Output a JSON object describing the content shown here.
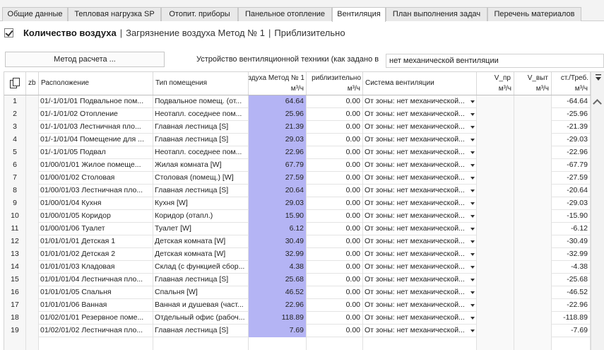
{
  "tabs": [
    {
      "label": "Общие данные",
      "active": false
    },
    {
      "label": "Тепловая нагрузка SP",
      "active": false
    },
    {
      "label": "Отопит. приборы",
      "active": false
    },
    {
      "label": "Панельное отопление",
      "active": false
    },
    {
      "label": "Вентиляция",
      "active": true
    },
    {
      "label": "План выполнения задач",
      "active": false
    },
    {
      "label": "Перечень материалов",
      "active": false
    }
  ],
  "headline": {
    "checked": true,
    "main": "Количество воздуха",
    "sep1": "|",
    "sub1": "Загрязнение воздуха Метод № 1",
    "sep2": "|",
    "sub2": "Приблизительно"
  },
  "controls": {
    "method_button": "Метод расчета ...",
    "device_label": "Устройство вентиляционной техники (как задано в",
    "device_value": "нет механической вентиляции"
  },
  "grid": {
    "headers": {
      "zb": "zb",
      "location": "Расположение",
      "room_type": "Тип помещения",
      "method1": "здуха Метод № 1",
      "method1_unit": "м³/ч",
      "approx": "риблизительно",
      "approx_unit": "м³/ч",
      "system": "Система вентиляции",
      "v_pr": "V_пр",
      "v_pr_unit": "м³/ч",
      "v_vyt": "V_выт",
      "v_vyt_unit": "м³/ч",
      "req": "ст./Треб.",
      "req_unit": "м³/ч"
    },
    "rows": [
      {
        "n": "1",
        "loc": "01/-1/01/01 Подвальное пом...",
        "type": "Подвальное помещ. (от...",
        "m1": "64.64",
        "m2": "0.00",
        "sys": "От зоны: нет механической...",
        "req": "-64.64"
      },
      {
        "n": "2",
        "loc": "01/-1/01/02 Отопление",
        "type": "Неотапл. соседнее пом...",
        "m1": "25.96",
        "m2": "0.00",
        "sys": "От зоны: нет механической...",
        "req": "-25.96"
      },
      {
        "n": "3",
        "loc": "01/-1/01/03 Лестничная пло...",
        "type": "Главная лестница [S]",
        "m1": "21.39",
        "m2": "0.00",
        "sys": "От зоны: нет механической...",
        "req": "-21.39"
      },
      {
        "n": "4",
        "loc": "01/-1/01/04 Помещение для ...",
        "type": "Главная лестница [S]",
        "m1": "29.03",
        "m2": "0.00",
        "sys": "От зоны: нет механической...",
        "req": "-29.03"
      },
      {
        "n": "5",
        "loc": "01/-1/01/05 Подвал",
        "type": "Неотапл. соседнее пом...",
        "m1": "22.96",
        "m2": "0.00",
        "sys": "От зоны: нет механической...",
        "req": "-22.96"
      },
      {
        "n": "6",
        "loc": "01/00/01/01 Жилое помеще...",
        "type": "Жилая комната [W]",
        "m1": "67.79",
        "m2": "0.00",
        "sys": "От зоны: нет механической...",
        "req": "-67.79"
      },
      {
        "n": "7",
        "loc": "01/00/01/02 Столовая",
        "type": "Столовая (помещ.) [W]",
        "m1": "27.59",
        "m2": "0.00",
        "sys": "От зоны: нет механической...",
        "req": "-27.59"
      },
      {
        "n": "8",
        "loc": "01/00/01/03 Лестничная пло...",
        "type": "Главная лестница [S]",
        "m1": "20.64",
        "m2": "0.00",
        "sys": "От зоны: нет механической...",
        "req": "-20.64"
      },
      {
        "n": "9",
        "loc": "01/00/01/04 Кухня",
        "type": "Кухня [W]",
        "m1": "29.03",
        "m2": "0.00",
        "sys": "От зоны: нет механической...",
        "req": "-29.03"
      },
      {
        "n": "10",
        "loc": "01/00/01/05 Коридор",
        "type": "Коридор (отапл.)",
        "m1": "15.90",
        "m2": "0.00",
        "sys": "От зоны: нет механической...",
        "req": "-15.90"
      },
      {
        "n": "11",
        "loc": "01/00/01/06 Туалет",
        "type": "Туалет [W]",
        "m1": "6.12",
        "m2": "0.00",
        "sys": "От зоны: нет механической...",
        "req": "-6.12"
      },
      {
        "n": "12",
        "loc": "01/01/01/01 Детская 1",
        "type": "Детская комната [W]",
        "m1": "30.49",
        "m2": "0.00",
        "sys": "От зоны: нет механической...",
        "req": "-30.49"
      },
      {
        "n": "13",
        "loc": "01/01/01/02 Детская 2",
        "type": "Детская комната [W]",
        "m1": "32.99",
        "m2": "0.00",
        "sys": "От зоны: нет механической...",
        "req": "-32.99"
      },
      {
        "n": "14",
        "loc": "01/01/01/03 Кладовая",
        "type": "Склад (с функцией сбор...",
        "m1": "4.38",
        "m2": "0.00",
        "sys": "От зоны: нет механической...",
        "req": "-4.38"
      },
      {
        "n": "15",
        "loc": "01/01/01/04 Лестничная пло...",
        "type": "Главная лестница [S]",
        "m1": "25.68",
        "m2": "0.00",
        "sys": "От зоны: нет механической...",
        "req": "-25.68"
      },
      {
        "n": "16",
        "loc": "01/01/01/05 Спальня",
        "type": "Спальня [W]",
        "m1": "46.52",
        "m2": "0.00",
        "sys": "От зоны: нет механической...",
        "req": "-46.52"
      },
      {
        "n": "17",
        "loc": "01/01/01/06 Ванная",
        "type": "Ванная и душевая (част...",
        "m1": "22.96",
        "m2": "0.00",
        "sys": "От зоны: нет механической...",
        "req": "-22.96"
      },
      {
        "n": "18",
        "loc": "01/02/01/01 Резервное поме...",
        "type": "Отдельный офис (рабоч...",
        "m1": "118.89",
        "m2": "0.00",
        "sys": "От зоны: нет механической...",
        "req": "-118.89"
      },
      {
        "n": "19",
        "loc": "01/02/01/02 Лестничная пло...",
        "type": "Главная лестница [S]",
        "m1": "7.69",
        "m2": "0.00",
        "sys": "От зоны: нет механической...",
        "req": "-7.69"
      }
    ]
  },
  "icons": {
    "copy": "copy-icon",
    "column_menu": "column-menu-icon",
    "scroll_up": "chevron-up-icon"
  }
}
